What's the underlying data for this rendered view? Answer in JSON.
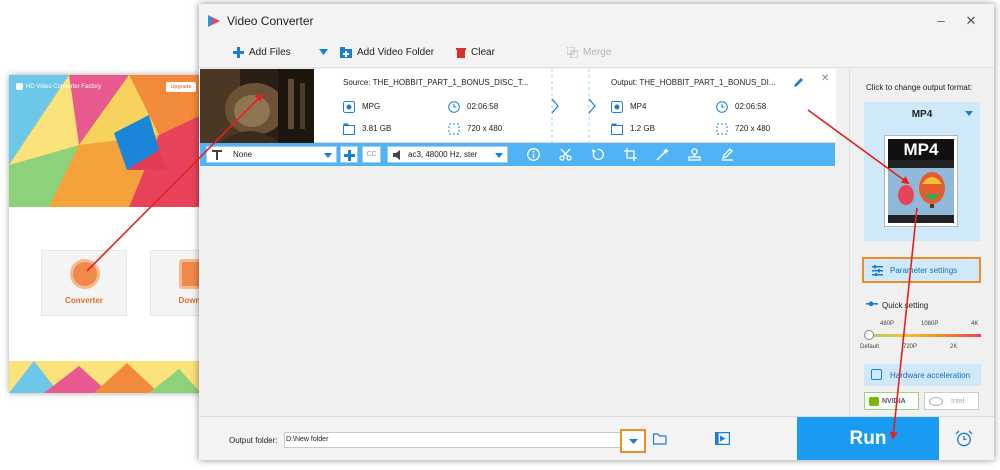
{
  "launcher": {
    "title": "HD Video Converter Factory",
    "upgrade_label": "Upgrade",
    "tiles": [
      {
        "label": "Converter"
      },
      {
        "label": "Downlo"
      }
    ]
  },
  "window": {
    "title": "Video Converter",
    "min_glyph": "–",
    "close_glyph": "✕"
  },
  "toolbar": {
    "add_files": "Add Files",
    "add_folder": "Add Video Folder",
    "clear": "Clear",
    "merge": "Merge"
  },
  "file": {
    "source_label": "Source: THE_HOBBIT_PART_1_BONUS_DISC_T...",
    "output_label": "Output: THE_HOBBIT_PART_1_BONUS_DI...",
    "source": {
      "format": "MPG",
      "duration": "02:06:58",
      "size": "3.81 GB",
      "resolution": "720 x 480"
    },
    "output": {
      "format": "MP4",
      "duration": "02:06:58",
      "size": "1.2 GB",
      "resolution": "720 x 480"
    },
    "subtitle": "None",
    "audio": "ac3, 48000 Hz, ster",
    "cc": "CC"
  },
  "right_panel": {
    "change_format_label": "Click to change output format:",
    "format_name": "MP4",
    "format_art_text": "MP4",
    "parameter_settings": "Parameter settings",
    "quick_setting": "Quick setting",
    "quality_top": [
      "480P",
      "1080P",
      "4K"
    ],
    "quality_bottom": [
      "Default",
      "720P",
      "2K"
    ],
    "hardware_acceleration": "Hardware acceleration",
    "nvidia": "NVIDIA",
    "intel": "Intel"
  },
  "bottom": {
    "output_folder_label": "Output folder:",
    "output_folder_value": "D:\\New folder",
    "run_label": "Run"
  },
  "colors": {
    "accent": "#1a9bf2",
    "file_bar": "#4fb3f5",
    "highlight_box": "#f08a22",
    "arrow": "#e8201c"
  }
}
